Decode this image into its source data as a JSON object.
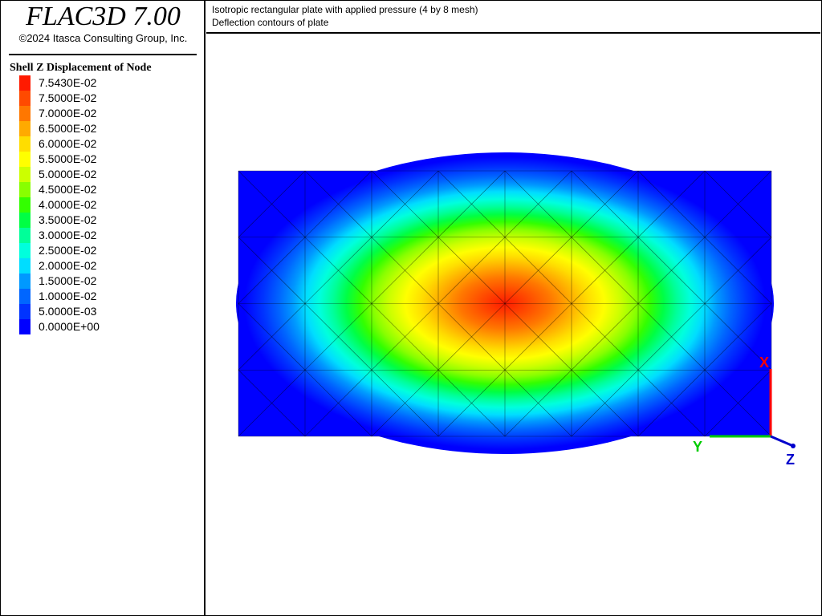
{
  "app": {
    "title": "FLAC3D 7.00",
    "copyright": "©2024 Itasca Consulting Group, Inc."
  },
  "header": {
    "line1": "Isotropic rectangular plate with applied pressure (4 by 8 mesh)",
    "line2": "Deflection contours of plate"
  },
  "legend": {
    "title": "Shell Z Displacement of Node",
    "entries": [
      {
        "label": "7.5430E-02",
        "color": "#ff1a00"
      },
      {
        "label": "7.5000E-02",
        "color": "#ff4a00"
      },
      {
        "label": "7.0000E-02",
        "color": "#ff7700"
      },
      {
        "label": "6.5000E-02",
        "color": "#ffaa00"
      },
      {
        "label": "6.0000E-02",
        "color": "#ffdd00"
      },
      {
        "label": "5.5000E-02",
        "color": "#ffff00"
      },
      {
        "label": "5.0000E-02",
        "color": "#ccff00"
      },
      {
        "label": "4.5000E-02",
        "color": "#88ff00"
      },
      {
        "label": "4.0000E-02",
        "color": "#33ff00"
      },
      {
        "label": "3.5000E-02",
        "color": "#00ff44"
      },
      {
        "label": "3.0000E-02",
        "color": "#00ff99"
      },
      {
        "label": "2.5000E-02",
        "color": "#00ffdd"
      },
      {
        "label": "2.0000E-02",
        "color": "#00ddff"
      },
      {
        "label": "1.5000E-02",
        "color": "#0099ff"
      },
      {
        "label": "1.0000E-02",
        "color": "#0066ff"
      },
      {
        "label": "5.0000E-03",
        "color": "#0033ff"
      },
      {
        "label": "0.0000E+00",
        "color": "#0000ff"
      }
    ]
  },
  "mesh": {
    "rows": 4,
    "cols": 8
  },
  "axes": {
    "x_label": "X",
    "y_label": "Y",
    "z_label": "Z",
    "x_color": "#ff0000",
    "y_color": "#00cc00",
    "z_color": "#0000cc"
  }
}
